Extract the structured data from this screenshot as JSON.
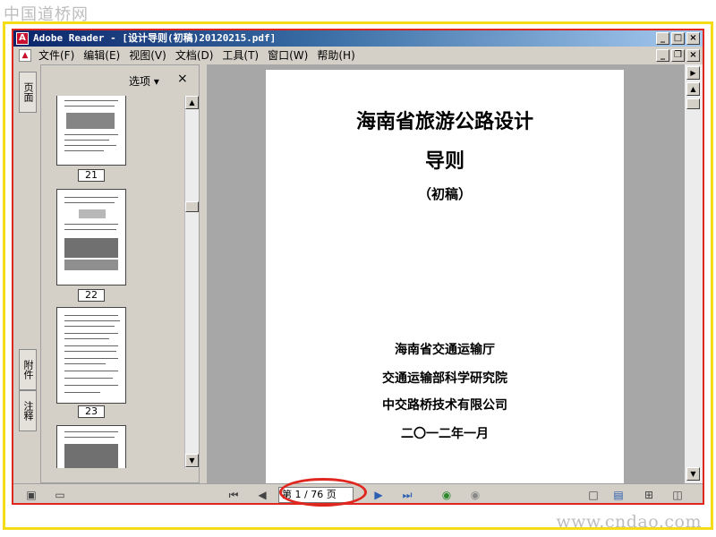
{
  "watermark_top": "中国道桥网",
  "watermark_bottom": "www.cndao.com",
  "window": {
    "title": "Adobe Reader - [设计导则(初稿)20120215.pdf]"
  },
  "menubar": {
    "items": [
      "文件(F)",
      "编辑(E)",
      "视图(V)",
      "文档(D)",
      "工具(T)",
      "窗口(W)",
      "帮助(H)"
    ]
  },
  "side_tabs": {
    "pages": "页面",
    "attachments": "附件",
    "comments": "注释"
  },
  "nav_panel": {
    "options_label": "选项 ▾",
    "close_label": "×",
    "thumbnails": [
      "21",
      "22",
      "23"
    ]
  },
  "document": {
    "title_line1": "海南省旅游公路设计",
    "title_line2": "导则",
    "subtitle": "（初稿）",
    "org1": "海南省交通运输厅",
    "org2": "交通运输部科学研究院",
    "org3": "中交路桥技术有限公司",
    "date": "二〇一二年一月"
  },
  "toolbar": {
    "page_indicator": "第 1 / 76 页",
    "current_page": 1,
    "total_pages": 76
  },
  "colors": {
    "frame_yellow": "#f4dd17",
    "frame_red": "#e0271f",
    "title_bar": "#0a246a"
  }
}
